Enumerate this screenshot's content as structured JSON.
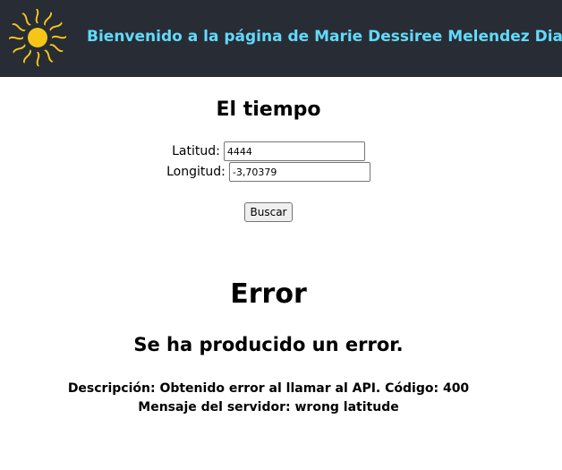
{
  "header": {
    "title": "Bienvenido a la página de Marie Dessiree Melendez Diaz",
    "logo_icon": "sun-icon",
    "logo_color": "#f5c518",
    "background": "#282c34",
    "title_color": "#61dafb"
  },
  "weather": {
    "title": "El tiempo",
    "latitude_label": "Latitud:",
    "latitude_value": "4444",
    "longitude_label": "Longitud:",
    "longitude_value": "-3,70379",
    "search_label": "Buscar"
  },
  "error": {
    "title": "Error",
    "subtitle": "Se ha producido un error.",
    "description": "Descripción: Obtenido error al llamar al API. Código: 400",
    "server_message": "Mensaje del servidor: wrong latitude"
  }
}
